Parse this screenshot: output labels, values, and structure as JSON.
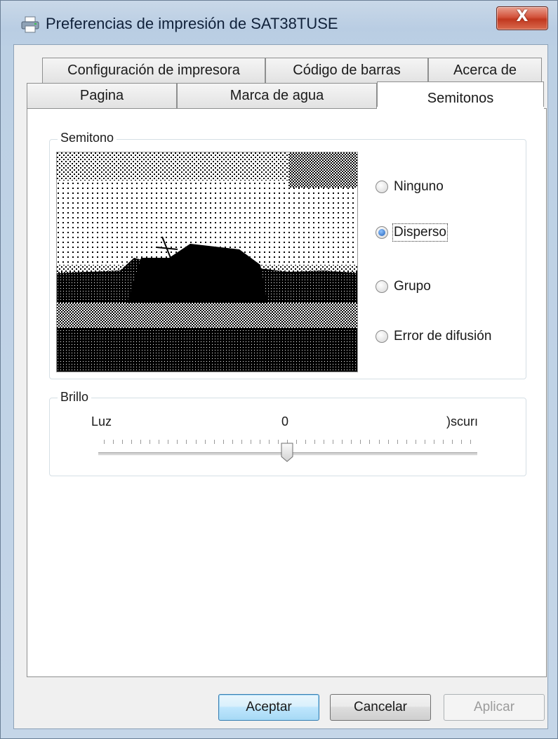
{
  "window": {
    "title": "Preferencias de impresión de SAT38TUSE",
    "close_label": "X",
    "icons": {
      "app": "printer-icon",
      "close": "close-icon"
    }
  },
  "tabs": {
    "back_row": [
      "Configuración de impresora",
      "Código de barras",
      "Acerca de"
    ],
    "front_row": [
      "Pagina",
      "Marca de agua",
      "Semitonos"
    ],
    "active": "Semitonos"
  },
  "halftone": {
    "group_label": "Semitono",
    "options": [
      "Ninguno",
      "Disperso",
      "Grupo",
      "Error de difusión"
    ],
    "selected": "Disperso"
  },
  "brightness": {
    "group_label": "Brillo",
    "min_label": "Luz",
    "value_label": "0",
    "max_label": ")scurı",
    "value": 0,
    "range": [
      -20,
      20
    ]
  },
  "buttons": {
    "ok": "Aceptar",
    "cancel": "Cancelar",
    "apply": "Aplicar"
  }
}
